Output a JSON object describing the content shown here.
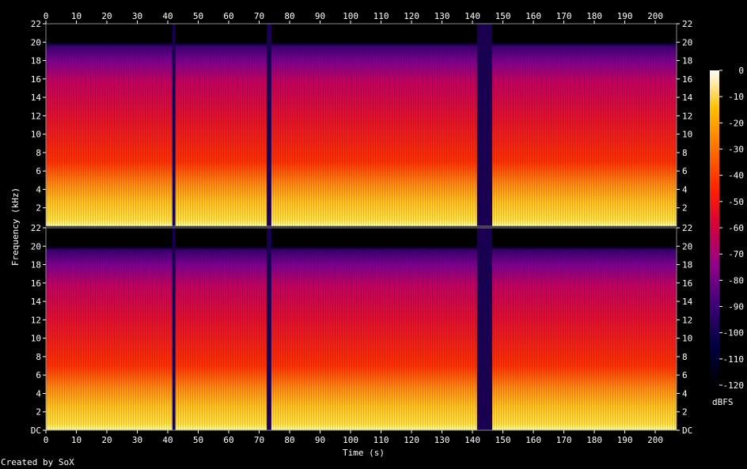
{
  "chart_data": {
    "type": "heatmap",
    "kind": "spectrogram",
    "title": "",
    "xlabel": "Time (s)",
    "ylabel": "Frequency (kHz)",
    "xlim": [
      0,
      207
    ],
    "x_ticks": [
      "0",
      "10",
      "20",
      "30",
      "40",
      "50",
      "60",
      "70",
      "80",
      "90",
      "100",
      "110",
      "120",
      "130",
      "140",
      "150",
      "160",
      "170",
      "180",
      "190",
      "200"
    ],
    "y_ticks": [
      "DC",
      "2",
      "4",
      "6",
      "8",
      "10",
      "12",
      "14",
      "16",
      "18",
      "20",
      "22"
    ],
    "ylim_khz": [
      0,
      22
    ],
    "channels": [
      "left",
      "right"
    ],
    "colorbar": {
      "label": "dBFS",
      "range": [
        -120,
        0
      ],
      "ticks": [
        "0",
        "-10",
        "-20",
        "-30",
        "-40",
        "-50",
        "-60",
        "-70",
        "-80",
        "-90",
        "-100",
        "-110",
        "-120"
      ]
    },
    "gaps_s": [
      [
        41.5,
        42.5
      ],
      [
        72.5,
        74.0
      ],
      [
        141.5,
        146.5
      ]
    ],
    "lowpass_cutoff_khz": 20,
    "credit": "Created by SoX"
  }
}
